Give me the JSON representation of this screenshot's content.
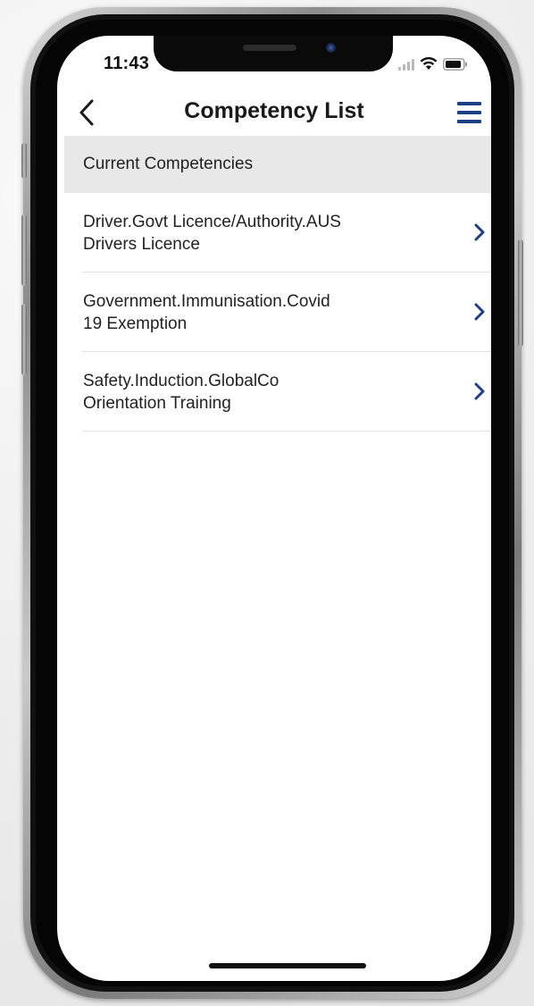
{
  "status_bar": {
    "time": "11:43"
  },
  "navbar": {
    "title": "Competency List",
    "back_icon": "chevron-left-icon",
    "menu_icon": "hamburger-menu-icon"
  },
  "section": {
    "header": "Current Competencies"
  },
  "competencies": [
    {
      "line1": "Driver.Govt Licence/Authority.AUS",
      "line2": "Drivers Licence"
    },
    {
      "line1": "Government.Immunisation.Covid",
      "line2": "19 Exemption"
    },
    {
      "line1": "Safety.Induction.GlobalCo",
      "line2": "Orientation Training"
    }
  ],
  "colors": {
    "accent": "#1d3f86",
    "section_bg": "#e8e8e8",
    "text": "#222222"
  }
}
